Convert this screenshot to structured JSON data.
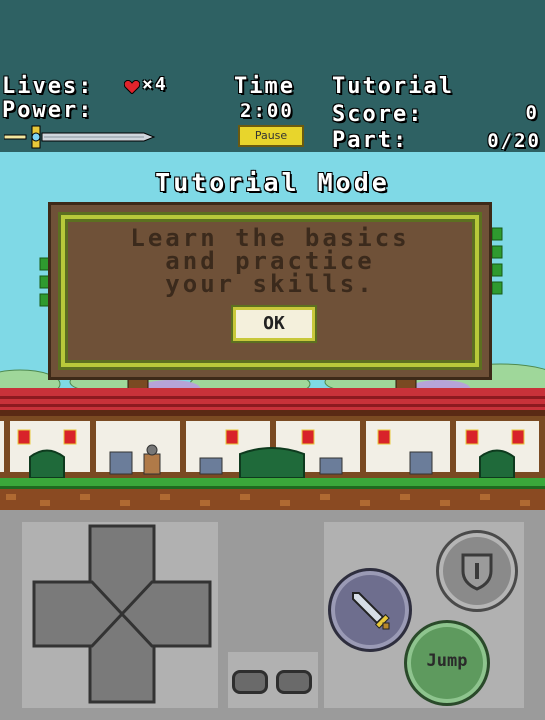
{
  "hud": {
    "lives_label": "Lives:",
    "lives_count": "×4",
    "power_label": "Power:",
    "time_label": "Time",
    "time_value": "2:00",
    "pause_label": "Pause",
    "mode_label": "Tutorial",
    "score_label": "Score:",
    "score_value": "0",
    "part_label": "Part:",
    "part_value": "0/20"
  },
  "scene": {
    "mode_title": "Tutorial Mode",
    "message": "Learn the basics\nand practice\nyour skills.",
    "ok_label": "OK"
  },
  "controls": {
    "jump_label": "Jump"
  },
  "colors": {
    "hud_bg": "#2e6163",
    "sky": "#7fd9e6",
    "board": "#6f5138",
    "frame": "#b8c93a",
    "jump_button": "#5e9a5e",
    "attack_button": "#6e6e8e"
  },
  "icons": {
    "heart": "heart-icon",
    "sword": "sword-icon",
    "shield": "shield-icon"
  }
}
